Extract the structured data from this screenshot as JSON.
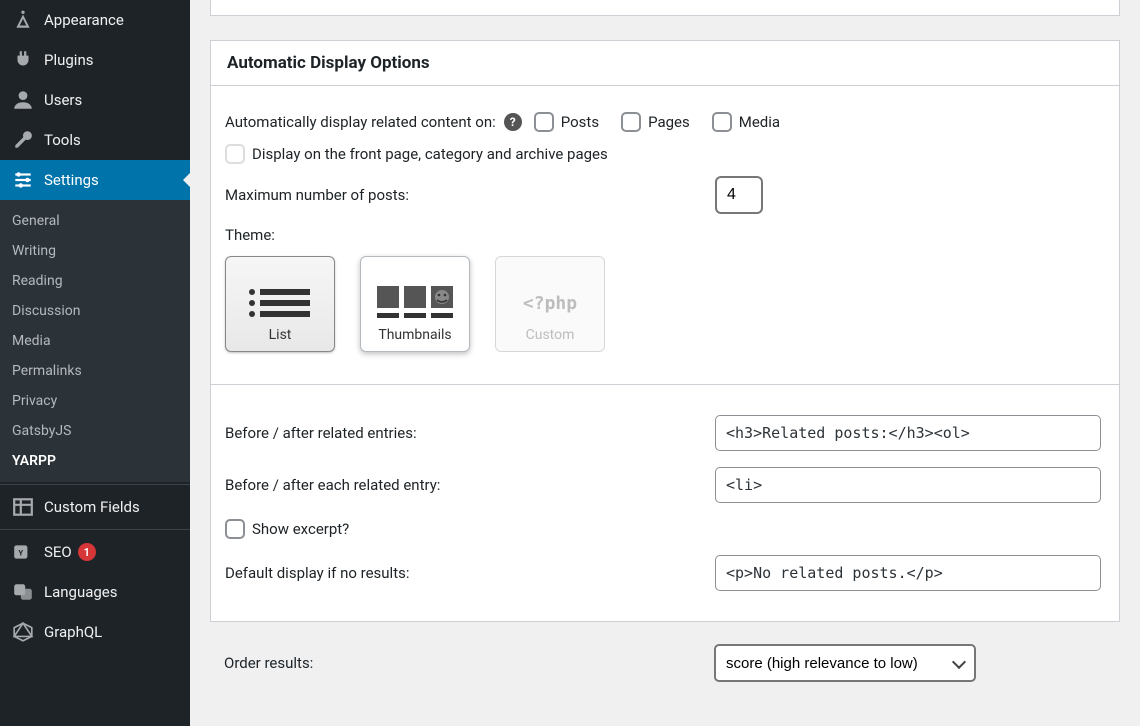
{
  "sidebar": {
    "items": [
      {
        "label": "Appearance",
        "slug": "appearance",
        "icon": "appearance"
      },
      {
        "label": "Plugins",
        "slug": "plugins",
        "icon": "plugins"
      },
      {
        "label": "Users",
        "slug": "users",
        "icon": "users"
      },
      {
        "label": "Tools",
        "slug": "tools",
        "icon": "tools"
      },
      {
        "label": "Settings",
        "slug": "settings",
        "icon": "settings",
        "active": true
      }
    ],
    "submenu": [
      {
        "label": "General"
      },
      {
        "label": "Writing"
      },
      {
        "label": "Reading"
      },
      {
        "label": "Discussion"
      },
      {
        "label": "Media"
      },
      {
        "label": "Permalinks"
      },
      {
        "label": "Privacy"
      },
      {
        "label": "GatsbyJS"
      },
      {
        "label": "YARPP",
        "current": true
      }
    ],
    "items2": [
      {
        "label": "Custom Fields",
        "slug": "custom-fields",
        "icon": "grid"
      },
      {
        "label": "SEO",
        "slug": "seo",
        "icon": "seo",
        "badge": "1"
      },
      {
        "label": "Languages",
        "slug": "languages",
        "icon": "languages"
      },
      {
        "label": "GraphQL",
        "slug": "graphql",
        "icon": "graphql"
      }
    ]
  },
  "panel": {
    "title": "Automatic Display Options",
    "autodisplay_label": "Automatically display related content on:",
    "cb_posts": "Posts",
    "cb_pages": "Pages",
    "cb_media": "Media",
    "cb_front": "Display on the front page, category and archive pages",
    "max_label": "Maximum number of posts:",
    "max_value": "4",
    "theme_label": "Theme:",
    "themes": [
      {
        "name": "List",
        "slug": "list"
      },
      {
        "name": "Thumbnails",
        "slug": "thumbnails"
      },
      {
        "name": "Custom",
        "slug": "custom",
        "php": "<?php"
      }
    ],
    "before_entries_label": "Before / after related entries:",
    "before_entries_value": "<h3>Related posts:</h3><ol>",
    "before_each_label": "Before / after each related entry:",
    "before_each_value": "<li>",
    "show_excerpt": "Show excerpt?",
    "no_results_label": "Default display if no results:",
    "no_results_value": "<p>No related posts.</p>",
    "order_label": "Order results:",
    "order_value": "score (high relevance to low)"
  }
}
